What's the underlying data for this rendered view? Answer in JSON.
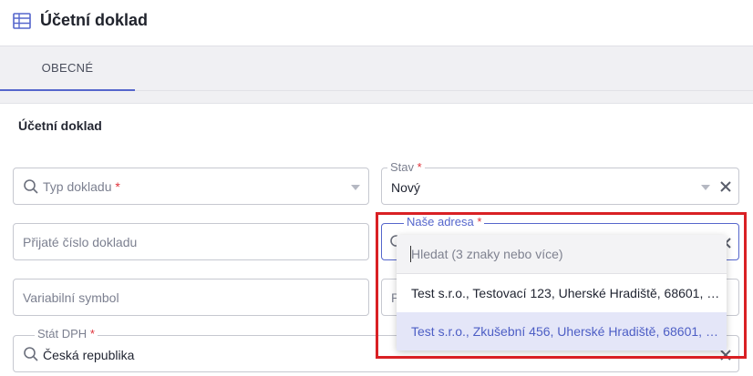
{
  "header": {
    "title": "Účetní doklad",
    "icon": "table-icon"
  },
  "tabs": [
    {
      "label": "OBECNÉ",
      "active": true
    }
  ],
  "section": {
    "title": "Účetní doklad"
  },
  "fields": {
    "typ_dokladu": {
      "placeholder": "Typ dokladu",
      "required_mark": "*"
    },
    "stav": {
      "legend": "Stav",
      "required_mark": "*",
      "value": "Nový"
    },
    "prijate_cislo": {
      "placeholder": "Přijaté číslo dokladu"
    },
    "nase_adresa": {
      "legend": "Naše adresa",
      "required_mark": "*"
    },
    "variabilni_symbol": {
      "placeholder": "Variabilní symbol"
    },
    "hidden_right_field": {
      "placeholder_start": "P"
    },
    "stat_dph": {
      "legend": "Stát DPH",
      "required_mark": "*",
      "value": "Česká republika"
    }
  },
  "dropdown": {
    "search_placeholder": "Hledat (3 znaky nebo více)",
    "options": [
      {
        "label": "Test s.r.o., Testovací 123, Uherské Hradiště, 68601, …",
        "highlighted": false
      },
      {
        "label": "Test s.r.o., Zkušební 456, Uherské Hradiště, 68601, …",
        "highlighted": true
      }
    ]
  },
  "colors": {
    "accent": "#5566cc",
    "required": "#e0323a",
    "annotation_border": "#d92024",
    "highlight_bg": "#e4e6f8"
  }
}
